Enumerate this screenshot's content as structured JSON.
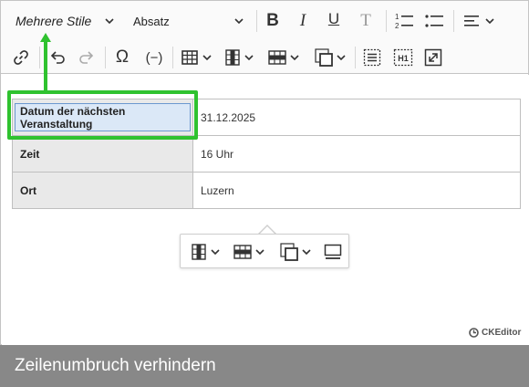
{
  "toolbar": {
    "style_dropdown": "Mehrere Stile",
    "heading_dropdown": "Absatz",
    "buttons": {
      "bold": "B",
      "italic": "I",
      "underline": "U",
      "remove_format": "T",
      "numbered_list": "1 2",
      "h1": "H1"
    }
  },
  "table": {
    "rows": [
      {
        "header": "Datum der nächsten Veranstaltung",
        "value": "31.12.2025"
      },
      {
        "header": "Zeit",
        "value": "16 Uhr"
      },
      {
        "header": "Ort",
        "value": "Luzern"
      }
    ]
  },
  "branding": {
    "label": "CKEditor"
  },
  "caption": "Zeilenumbruch verhindern",
  "colors": {
    "highlight": "#2fc22f",
    "caption_bg": "#888888",
    "selection": "#dbe8f7"
  }
}
